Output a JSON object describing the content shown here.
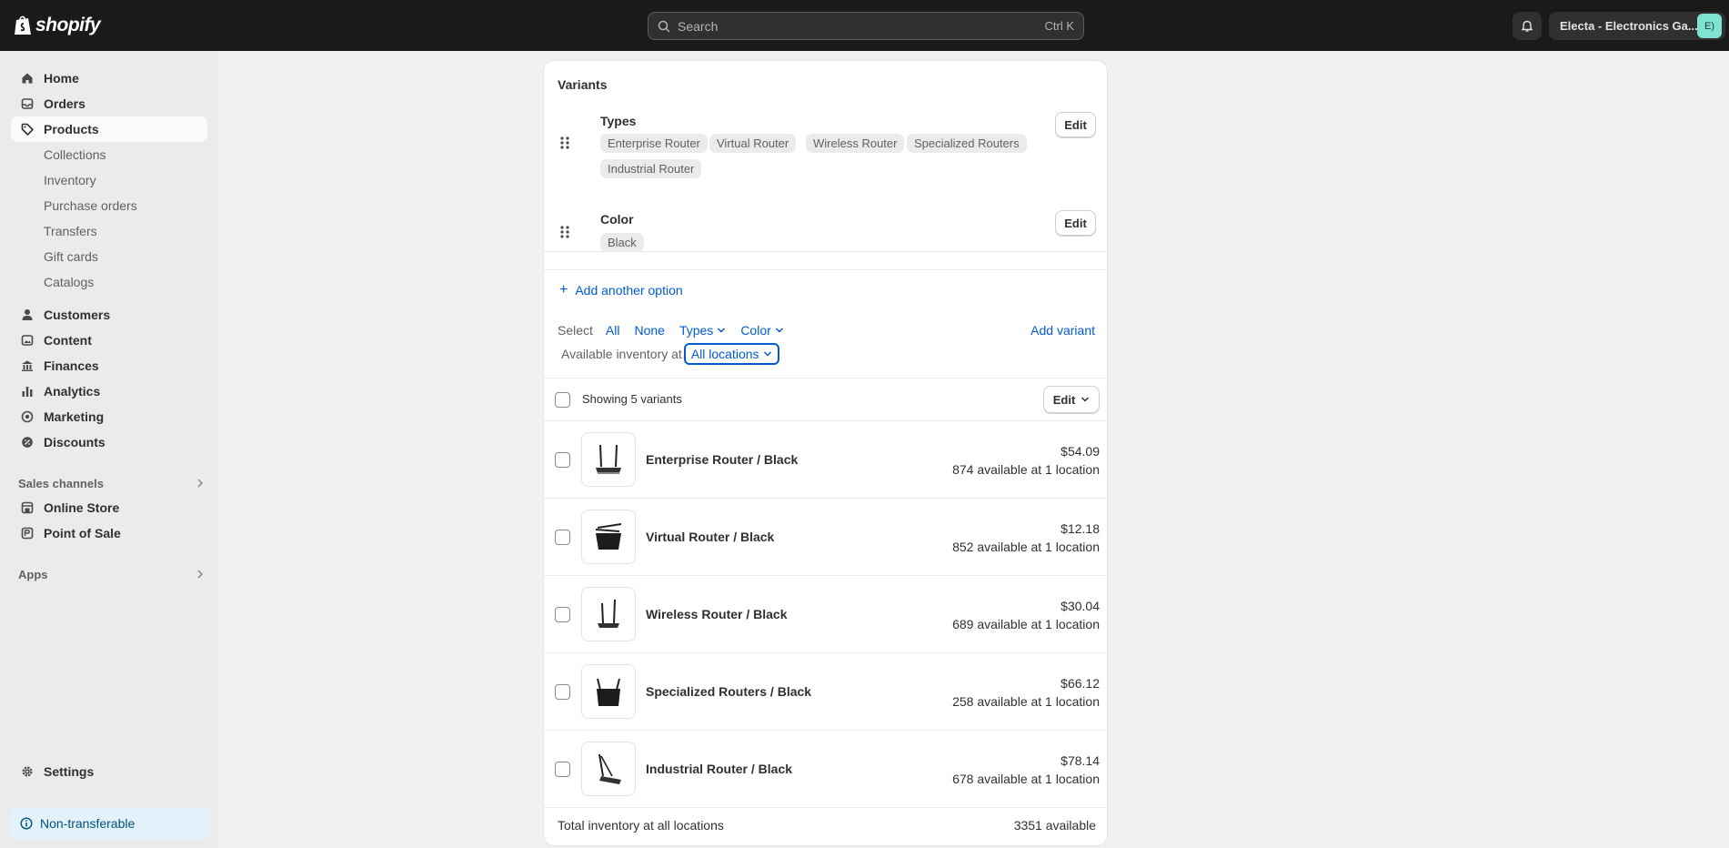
{
  "topbar": {
    "logo_text": "shopify",
    "search_placeholder": "Search",
    "search_shortcut": "Ctrl K",
    "store_name": "Electa - Electronics Ga...",
    "store_initials": "E)"
  },
  "sidebar": {
    "main": [
      {
        "label": "Home",
        "icon": "home-icon"
      },
      {
        "label": "Orders",
        "icon": "orders-icon"
      },
      {
        "label": "Products",
        "icon": "tag-icon",
        "active": true
      }
    ],
    "products_sub": [
      "Collections",
      "Inventory",
      "Purchase orders",
      "Transfers",
      "Gift cards",
      "Catalogs"
    ],
    "secondary": [
      {
        "label": "Customers",
        "icon": "person-icon"
      },
      {
        "label": "Content",
        "icon": "content-icon"
      },
      {
        "label": "Finances",
        "icon": "bank-icon"
      },
      {
        "label": "Analytics",
        "icon": "bar-chart-icon"
      },
      {
        "label": "Marketing",
        "icon": "target-icon"
      },
      {
        "label": "Discounts",
        "icon": "discount-icon"
      }
    ],
    "sales_channels_label": "Sales channels",
    "channels": [
      {
        "label": "Online Store",
        "icon": "store-icon"
      },
      {
        "label": "Point of Sale",
        "icon": "pos-icon"
      }
    ],
    "apps_label": "Apps",
    "settings_label": "Settings",
    "non_transferable_label": "Non-transferable"
  },
  "variants_card": {
    "title": "Variants",
    "options": [
      {
        "name": "Types",
        "edit_label": "Edit",
        "values": [
          "Enterprise Router",
          "Virtual Router",
          "Wireless Router",
          "Specialized Routers",
          "Industrial Router"
        ]
      },
      {
        "name": "Color",
        "edit_label": "Edit",
        "values": [
          "Black"
        ]
      }
    ],
    "add_option_label": "Add another option",
    "select_label": "Select",
    "select_all": "All",
    "select_none": "None",
    "filter_types": "Types",
    "filter_color": "Color",
    "add_variant_label": "Add variant",
    "available_at_label": "Available inventory at",
    "location_value": "All locations",
    "showing_label": "Showing 5 variants",
    "bulk_edit_label": "Edit",
    "variants": [
      {
        "name": "Enterprise Router / Black",
        "price": "$54.09",
        "availability": "874 available at 1 location"
      },
      {
        "name": "Virtual Router / Black",
        "price": "$12.18",
        "availability": "852 available at 1 location"
      },
      {
        "name": "Wireless Router / Black",
        "price": "$30.04",
        "availability": "689 available at 1 location"
      },
      {
        "name": "Specialized Routers / Black",
        "price": "$66.12",
        "availability": "258 available at 1 location"
      },
      {
        "name": "Industrial Router / Black",
        "price": "$78.14",
        "availability": "678 available at 1 location"
      }
    ],
    "total_label": "Total inventory at all locations",
    "total_value": "3351 available"
  }
}
